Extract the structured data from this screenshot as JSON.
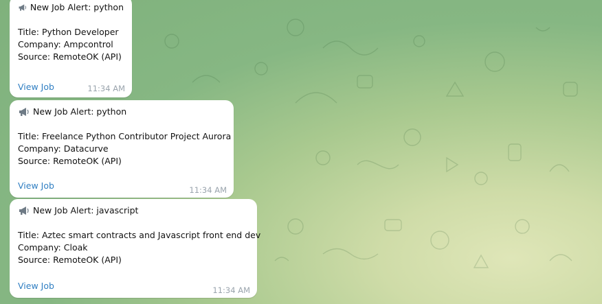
{
  "messages": [
    {
      "header": "New Job Alert: python",
      "title": "Title: Python Developer",
      "company": "Company: Ampcontrol",
      "source": "Source: RemoteOK (API)",
      "link": "View Job",
      "time": "11:34 AM"
    },
    {
      "header": "New Job Alert: python",
      "title": "Title: Freelance Python Contributor Project Aurora",
      "company": "Company: Datacurve",
      "source": "Source: RemoteOK (API)",
      "link": "View Job",
      "time": "11:34 AM"
    },
    {
      "header": "New Job Alert: javascript",
      "title": "Title: Aztec smart contracts and Javascript front end dev",
      "company": "Company: Cloak",
      "source": "Source: RemoteOK (API)",
      "link": "View Job",
      "time": "11:34 AM"
    }
  ],
  "icons": {
    "alert": "megaphone-icon"
  }
}
